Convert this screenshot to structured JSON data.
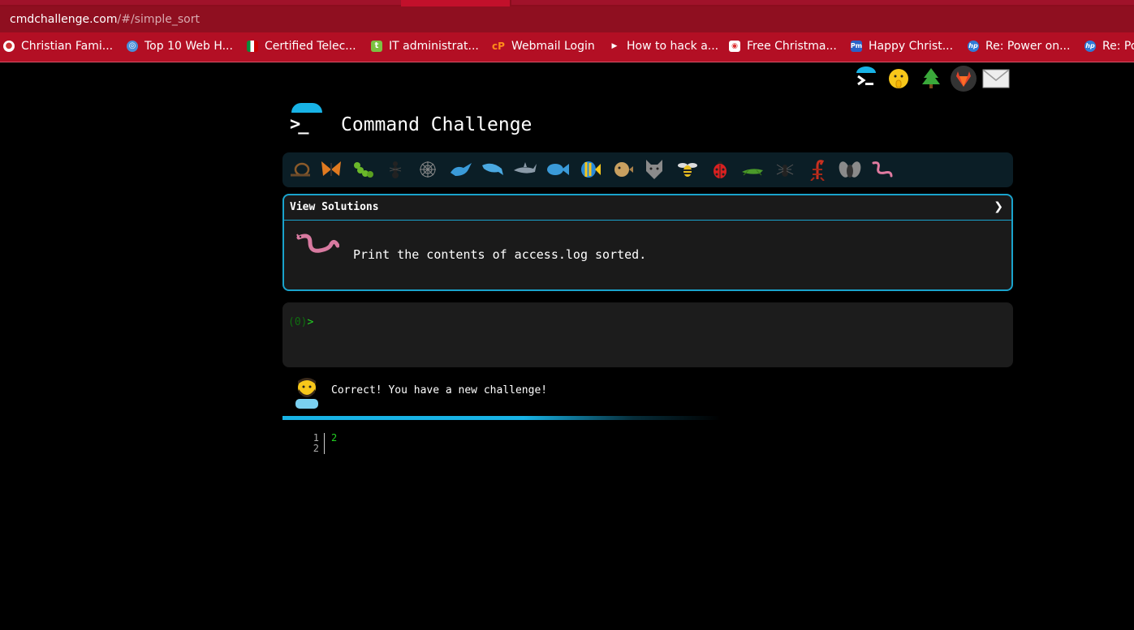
{
  "browser": {
    "url_domain": "cmdchallenge.com",
    "url_path": "/#/simple_sort",
    "bookmarks": [
      {
        "label": "Christian Fami...",
        "icon": "globe-icon"
      },
      {
        "label": "Top 10 Web H...",
        "icon": "globe-icon"
      },
      {
        "label": "Certified Telec...",
        "icon": "flag-icon"
      },
      {
        "label": "IT administrat...",
        "icon": "t-icon"
      },
      {
        "label": "Webmail Login",
        "icon": "cpanel-icon"
      },
      {
        "label": "How to hack a...",
        "icon": "play-icon"
      },
      {
        "label": "Free Christma...",
        "icon": "site-icon"
      },
      {
        "label": "Happy Christ...",
        "icon": "pm-icon"
      },
      {
        "label": "Re: Power on...",
        "icon": "hp-icon"
      },
      {
        "label": "Re: Po",
        "icon": "hp-icon"
      }
    ]
  },
  "header_icons": [
    "terminal-icon",
    "shush-face-icon",
    "tree-icon",
    "gitlab-icon",
    "mail-icon"
  ],
  "page": {
    "title": "Command Challenge"
  },
  "animals": [
    "snail",
    "butterfly",
    "caterpillar",
    "ant",
    "spiderweb",
    "whale",
    "dolphin",
    "shark",
    "fish",
    "tropical-fish",
    "blowfish",
    "wolf",
    "bee",
    "ladybug",
    "cricket",
    "spider",
    "scorpion",
    "fly",
    "worm"
  ],
  "challenge": {
    "view_solutions_label": "View Solutions",
    "chevron": "❯",
    "description": "Print the contents of access.log sorted."
  },
  "terminal": {
    "exit_code": "(0)",
    "prompt_symbol": ">"
  },
  "feedback": {
    "message": "Correct! You have a new challenge!"
  },
  "editor": {
    "line_numbers": [
      "1",
      "2"
    ],
    "content": "2"
  },
  "colors": {
    "accent": "#18b3e6",
    "prompt_green": "#22d022",
    "browser_red": "#b30f24"
  }
}
